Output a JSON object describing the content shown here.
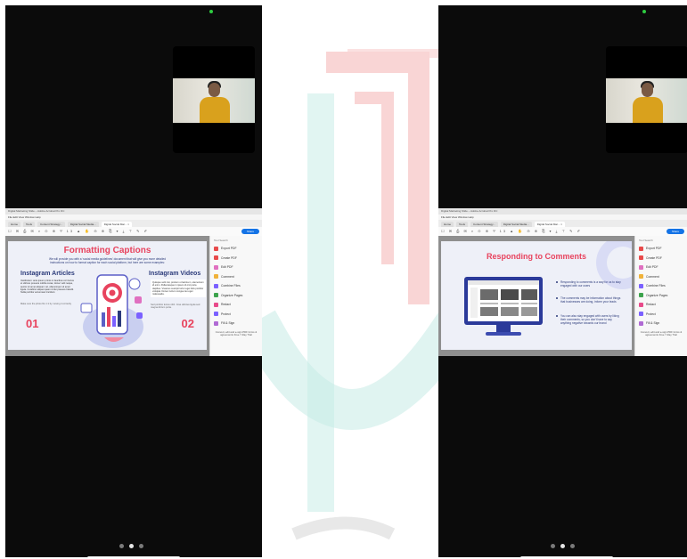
{
  "colors": {
    "accent_red": "#e8435e",
    "accent_navy": "#2b3a7a",
    "share_blue": "#1473e6",
    "phone_bg": "#0b0b0b",
    "watermark_red": "#f5c3c3",
    "watermark_teal": "#c8ece8"
  },
  "window": {
    "browser_title": "Digital Marketing Slide – Adobe Acrobat Pro DC",
    "menu": "File  Edit  View  Window  Help"
  },
  "tabs": [
    {
      "label": "Home"
    },
    {
      "label": "Tools"
    },
    {
      "label": "Content Strategy..."
    },
    {
      "label": "Digital Social Media..."
    },
    {
      "label": "Digital Social Mar... ×"
    }
  ],
  "toolbar": {
    "icons": "☐ ✉ ⎙ ✉ ⌕   ⊙ ⊕  ⅟ 13   ▲ ✋ ⊖ ⊕ ⎘ ▾   ⤓ ⊤ ✎ ✐",
    "share_label": "Share"
  },
  "side_panel": {
    "header": "Tool Search",
    "items": [
      {
        "label": "Export PDF",
        "icon": "export-pdf-icon",
        "color": "#e84b4b"
      },
      {
        "label": "Create PDF",
        "icon": "create-pdf-icon",
        "color": "#e84b4b"
      },
      {
        "label": "Edit PDF",
        "icon": "edit-pdf-icon",
        "color": "#e070c0"
      },
      {
        "label": "Comment",
        "icon": "comment-icon",
        "color": "#f0b23a"
      },
      {
        "label": "Combine Files",
        "icon": "combine-files-icon",
        "color": "#7b61ff"
      },
      {
        "label": "Organize Pages",
        "icon": "organize-pages-icon",
        "color": "#3da34d"
      },
      {
        "label": "Redact",
        "icon": "redact-icon",
        "color": "#e84b8a"
      },
      {
        "label": "Protect",
        "icon": "protect-icon",
        "color": "#7b61ff"
      },
      {
        "label": "Fill & Sign",
        "icon": "fill-sign-icon",
        "color": "#b06ad4"
      }
    ],
    "footer": "Convert, edit and e-sign PDF forms & agreements\nFree 7-Day Trial"
  },
  "slide_left": {
    "title": "Formatting Captions",
    "subtitle": "We will provide you with a ‘social media guidelines’ document that will give you more detailed instructions on how to format caption for each social platform, but here are some examples:",
    "left_heading": "Instagram Articles",
    "left_text": "Vestibulum: ante ipsum primis in faucibus orci luctus et ultrices posuere cubilia curae; donec velit neque, auctor sit amet aliquam vel, ullamcorper sit amet ligula. Curabitur aliquet quam id dui posuere blandit. Nulla porttitor accumsan tincidunt.",
    "left_note": "Make sure the photo fits 1:1 by moving it correctly",
    "right_heading": "Instagram Videos",
    "right_text": "Quisque velit nisi, pretium ut lacinia in, elementum id enim. Pellentesque in ipsum id orci porta dapibus. Vivamus suscipit tortor eget felis porttitor volutpat. Donec rutrum congue leo eget malesuada.",
    "right_note": "Sed porttitor lectus nibh. Cras ultricies ligula sed magna dictum porta.",
    "num_left": "01",
    "num_right": "02"
  },
  "slide_right": {
    "title": "Responding to Comments",
    "bullets": [
      "Responding to comments is a way for us to stay engaged with our users",
      "The comments may be information about things that businesses are doing, inform your leads",
      "You can also stay engaged with users by liking their comments, so you don't have to say anything negative towards our brand"
    ]
  },
  "pager": {
    "left_active": 1,
    "right_active": 1
  }
}
